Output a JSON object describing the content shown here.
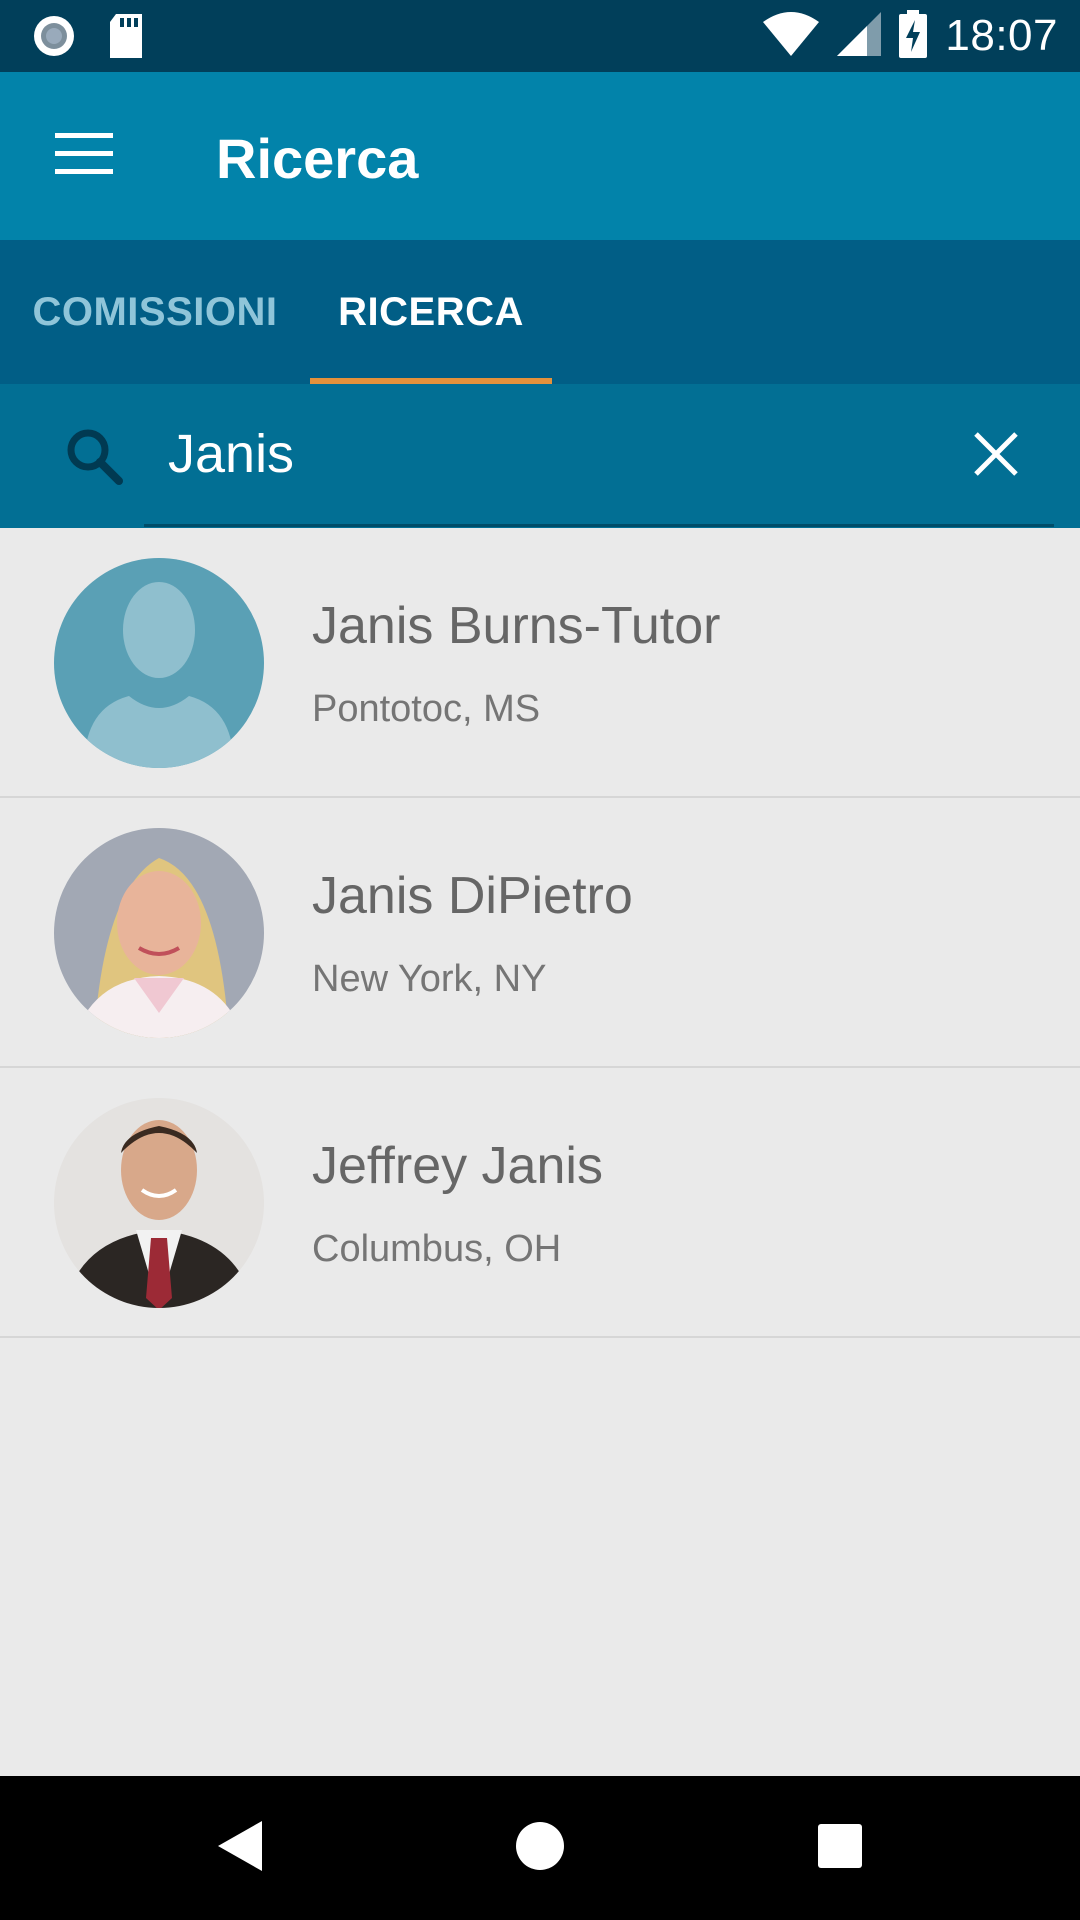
{
  "status_bar": {
    "time": "18:07",
    "icons": [
      "record-icon",
      "sd-card-icon",
      "wifi-icon",
      "signal-icon",
      "battery-charging-icon"
    ]
  },
  "app_bar": {
    "title": "Ricerca",
    "menu_icon": "hamburger-menu-icon"
  },
  "tabs": [
    {
      "label": "COMISSIONI",
      "selected": false
    },
    {
      "label": "RICERCA",
      "selected": true
    }
  ],
  "search": {
    "value": "Janis",
    "search_icon": "search-icon",
    "clear_icon": "close-icon"
  },
  "results": [
    {
      "name": "Janis Burns-Tutor",
      "location": "Pontotoc, MS",
      "avatar": "default-avatar-silhouette"
    },
    {
      "name": "Janis DiPietro",
      "location": "New York, NY",
      "avatar": "photo-blonde-woman"
    },
    {
      "name": "Jeffrey Janis",
      "location": "Columbus, OH",
      "avatar": "photo-man-in-suit"
    }
  ],
  "nav_bar": {
    "icons": [
      "back-icon",
      "home-icon",
      "recents-icon"
    ]
  },
  "colors": {
    "status_bar": "#013f5a",
    "app_bar": "#0283aa",
    "tabs": "#015e86",
    "search_bar": "#026f94",
    "tab_indicator": "#e5913b",
    "background": "#eaeaea"
  }
}
